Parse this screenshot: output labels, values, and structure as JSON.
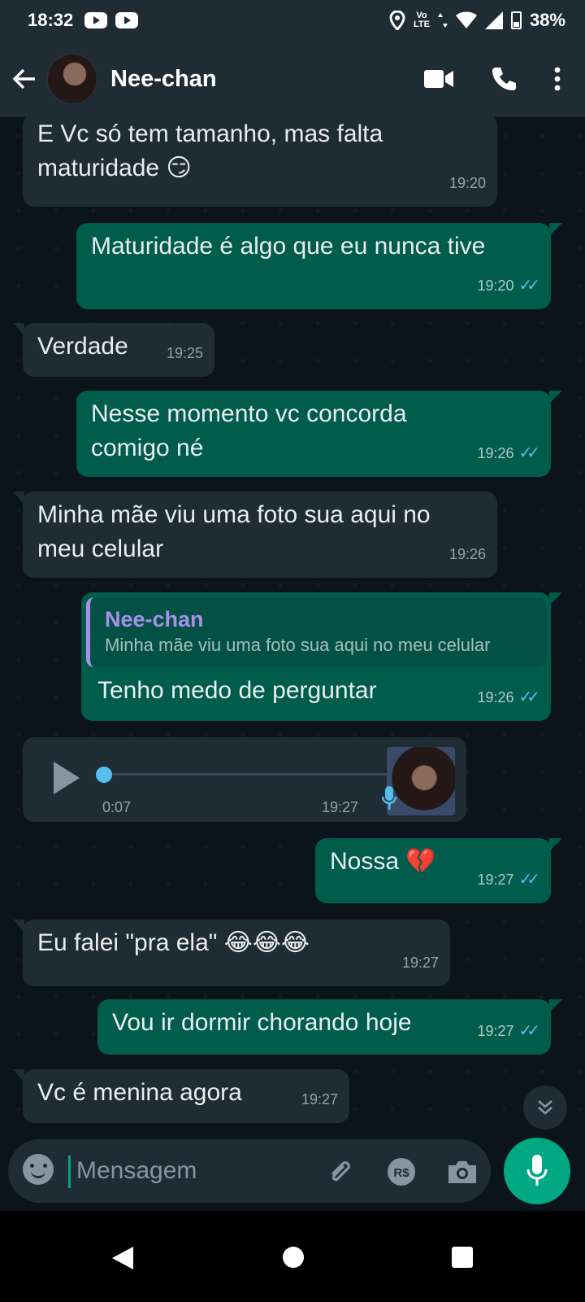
{
  "status_bar": {
    "time": "18:32",
    "network_top": "Vo",
    "network_bottom": "LTE",
    "battery": "38%"
  },
  "header": {
    "contact_name": "Nee-chan"
  },
  "messages": [
    {
      "side": "in",
      "text": "E Vc só tem tamanho, mas falta maturidade",
      "emoji": "😏",
      "time": "19:20"
    },
    {
      "side": "out",
      "text": "Maturidade é algo que eu nunca tive",
      "time": "19:20"
    },
    {
      "side": "in",
      "text": "Verdade",
      "time": "19:25"
    },
    {
      "side": "out",
      "text": "Nesse momento vc concorda comigo né",
      "time": "19:26"
    },
    {
      "side": "in",
      "text": "Minha mãe viu uma foto sua aqui no meu celular",
      "time": "19:26"
    },
    {
      "side": "out",
      "quote_name": "Nee-chan",
      "quote_text": "Minha mãe viu uma foto sua aqui no meu celular",
      "text": "Tenho medo de perguntar",
      "time": "19:26"
    },
    {
      "side": "in",
      "type": "voice",
      "duration": "0:07",
      "time": "19:27"
    },
    {
      "side": "out",
      "text": "Nossa",
      "emoji": "💔",
      "time": "19:27"
    },
    {
      "side": "in",
      "text": "Eu falei \"pra ela\"",
      "emoji": "😂😂😂",
      "time": "19:27"
    },
    {
      "side": "out",
      "text": "Vou ir dormir chorando hoje",
      "time": "19:27"
    },
    {
      "side": "in",
      "text": "Vc é menina agora",
      "time": "19:27"
    }
  ],
  "composer": {
    "placeholder": "Mensagem"
  },
  "colors": {
    "outgoing": "#005c4b",
    "incoming": "#202c33",
    "accent": "#00a884",
    "read_ticks": "#53bdeb",
    "quote_name": "#a791e8"
  }
}
